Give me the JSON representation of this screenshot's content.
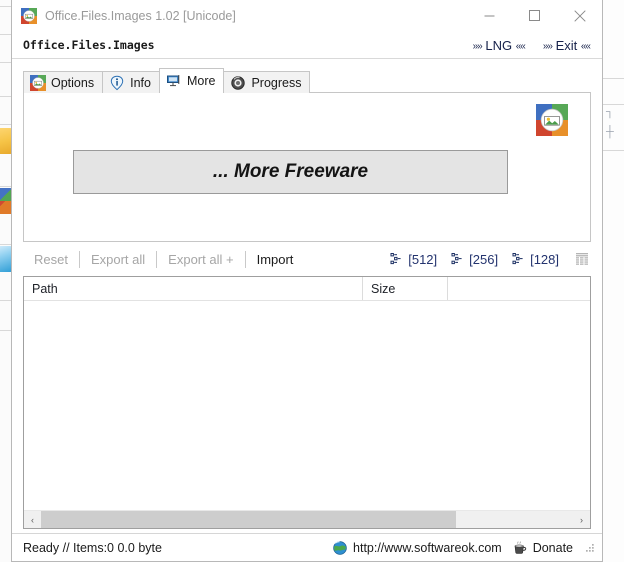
{
  "window": {
    "title": "Office.Files.Images 1.02 [Unicode]",
    "icon": "app-images-icon",
    "minimize_label": "minimize-icon",
    "maximize_label": "maximize-icon",
    "close_label": "close-icon"
  },
  "appbar": {
    "app_name": "Office.Files.Images",
    "lng_prefix": "»»",
    "lng_label": "LNG",
    "lng_suffix": "««",
    "exit_prefix": "»»",
    "exit_label": "Exit",
    "exit_suffix": "««"
  },
  "tabs": [
    {
      "label": "Options",
      "icon": "app-images-icon",
      "selected": false
    },
    {
      "label": "Info",
      "icon": "info-icon",
      "selected": false
    },
    {
      "label": "More",
      "icon": "monitor-icon",
      "selected": true
    },
    {
      "label": "Progress",
      "icon": "sphere-icon",
      "selected": false
    }
  ],
  "panel": {
    "more_freeware_label": "... More Freeware",
    "logo_icon": "app-images-icon"
  },
  "toolbar": {
    "buttons": [
      {
        "label": "Reset",
        "enabled": false
      },
      {
        "label": "Export all",
        "enabled": false
      },
      {
        "label": "Export all +",
        "enabled": false
      },
      {
        "label": "Import",
        "enabled": true
      }
    ],
    "size_buttons": [
      {
        "label": "[512]",
        "icon": "selection-dots-icon"
      },
      {
        "label": "[256]",
        "icon": "selection-dots-icon"
      },
      {
        "label": "[128]",
        "icon": "selection-dots-icon"
      }
    ],
    "grid_icon": "grid-list-icon"
  },
  "list": {
    "columns": [
      {
        "label": "Path"
      },
      {
        "label": "Size"
      },
      {
        "label": ""
      }
    ],
    "rows": []
  },
  "scrollbar": {
    "left_arrow": "‹",
    "right_arrow": "›",
    "thumb_percent": 78
  },
  "statusbar": {
    "status": "Ready // Items:0 0.0 byte",
    "website": "http://www.softwareok.com",
    "website_icon": "globe-icon",
    "donate": "Donate",
    "donate_icon": "coffee-cup-icon",
    "grip_icon": "resize-grip-icon"
  },
  "desktop": {
    "right_marks": [
      "┐",
      "┼"
    ]
  },
  "colors": {
    "accent_navy": "#23336e",
    "disabled_gray": "#a6a6a6",
    "title_gray": "#9a9a9a",
    "panel_button": "#e4e4e4"
  }
}
